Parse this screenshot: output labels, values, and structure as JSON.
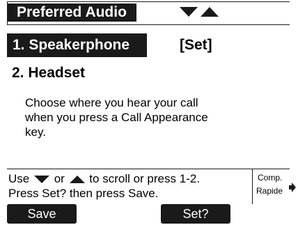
{
  "title_bar": {
    "title": "Preferred Audio",
    "scroll_icons": [
      "arrow-down-icon",
      "arrow-up-icon"
    ]
  },
  "items": [
    {
      "number_label": "1. Speakerphone",
      "status": "[Set]",
      "selected": true
    },
    {
      "number_label": "2. Headset",
      "status": "",
      "selected": false
    }
  ],
  "description": {
    "line1": "Choose where you hear your call",
    "line2": "when you press a Call Appearance",
    "line3": "key."
  },
  "help": {
    "line1_prefix": "Use",
    "line1_or": "or",
    "line1_suffix": "to scroll or press 1-2.",
    "line2": "Press Set? then press Save."
  },
  "comp_rapide": {
    "line1": "Comp.",
    "line2": "Rapide",
    "icon": "arrow-right-icon"
  },
  "softkeys": {
    "save_label": "Save",
    "set_label": "Set?"
  },
  "colors": {
    "highlight_bg": "#1a1a1a",
    "highlight_text": "#ffffff",
    "background": "#ffffff"
  }
}
